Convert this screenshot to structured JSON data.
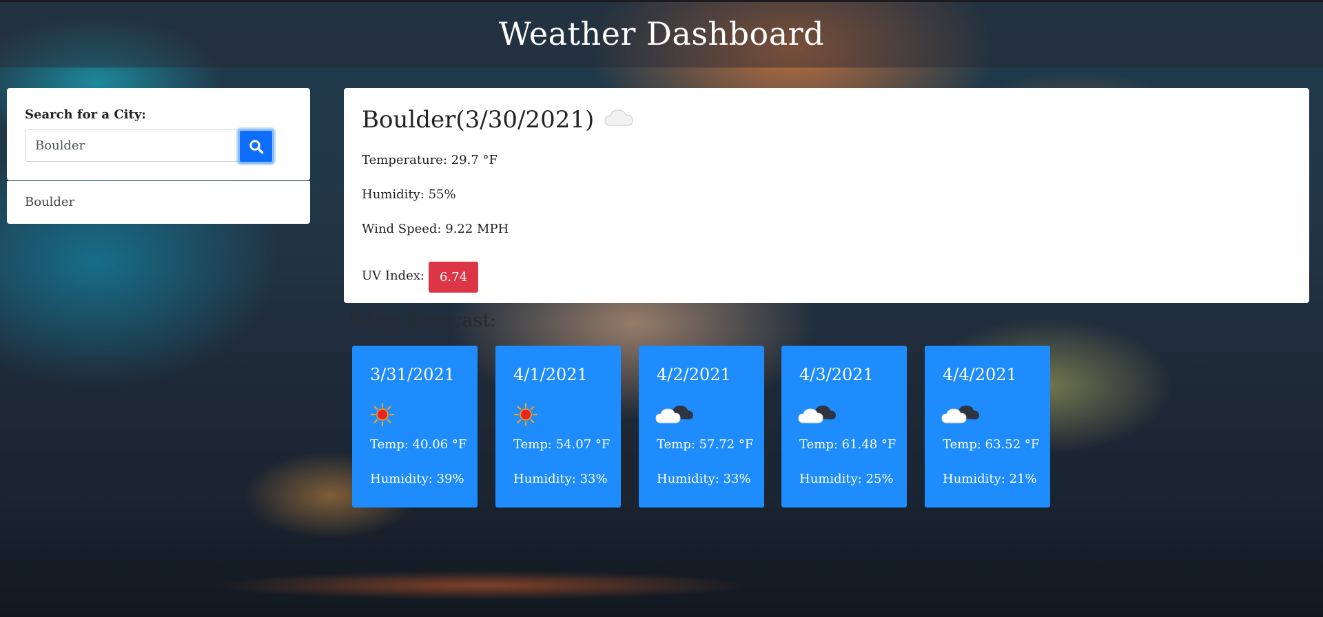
{
  "header": {
    "title": "Weather Dashboard"
  },
  "search": {
    "label": "Search for a City:",
    "input_value": "Boulder",
    "button_icon": "search-icon"
  },
  "history": {
    "items": [
      "Boulder"
    ]
  },
  "current": {
    "title": "Boulder(3/30/2021)",
    "icon": "cloud-icon",
    "temperature": "Temperature: 29.7 °F",
    "humidity": "Humidity: 55%",
    "wind": "Wind Speed: 9.22 MPH",
    "uv_label": "UV Index:",
    "uv_value": "6.74",
    "uv_color": "#dc3545"
  },
  "forecast": {
    "title": "5-Day Forecast:",
    "card_color": "#1e8cfd",
    "days": [
      {
        "date": "3/31/2021",
        "icon": "sun-icon",
        "temp": "Temp: 40.06 °F",
        "humidity": "Humidity: 39%"
      },
      {
        "date": "4/1/2021",
        "icon": "sun-icon",
        "temp": "Temp: 54.07 °F",
        "humidity": "Humidity: 33%"
      },
      {
        "date": "4/2/2021",
        "icon": "partly-cloudy-icon",
        "temp": "Temp: 57.72 °F",
        "humidity": "Humidity: 33%"
      },
      {
        "date": "4/3/2021",
        "icon": "partly-cloudy-icon",
        "temp": "Temp: 61.48 °F",
        "humidity": "Humidity: 25%"
      },
      {
        "date": "4/4/2021",
        "icon": "partly-cloudy-icon",
        "temp": "Temp: 63.52 °F",
        "humidity": "Humidity: 21%"
      }
    ]
  }
}
